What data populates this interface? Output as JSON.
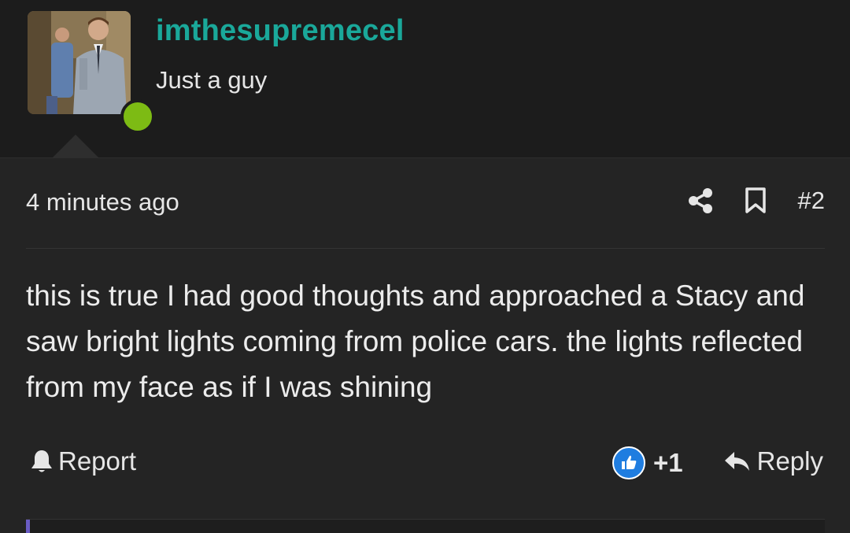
{
  "user": {
    "username": "imthesupremecel",
    "title": "Just a guy",
    "online": true,
    "status_color": "#7dbb14",
    "username_color": "#1aa89a"
  },
  "post": {
    "time": "4 minutes ago",
    "number": "#2",
    "share_icon": "share-icon",
    "bookmark_icon": "bookmark-icon",
    "body": "this is true I had good thoughts and approached a Stacy and saw bright lights coming from police cars. the lights reflected from my face as if I was shining"
  },
  "footer": {
    "report_label": "Report",
    "report_icon": "bell-icon",
    "reaction_icon": "thumbs-up-icon",
    "reaction_count": "+1",
    "reply_label": "Reply",
    "reply_icon": "reply-arrow-icon",
    "accent_color": "#1f7de0"
  }
}
